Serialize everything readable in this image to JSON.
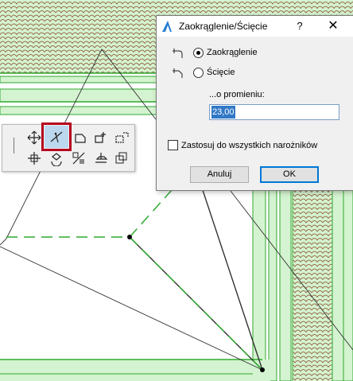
{
  "dialog": {
    "title": "Zaokrąglenie/Ścięcie",
    "help": "?",
    "close": "✕",
    "options": [
      {
        "label": "Zaokrąglenie",
        "checked": true
      },
      {
        "label": "Ścięcie",
        "checked": false
      }
    ],
    "radius_label": "...o promieniu:",
    "radius_value": "23,00",
    "all_corners_label": "Zastosuj do wszystkich narożników",
    "all_corners_checked": false,
    "cancel_label": "Anuluj",
    "ok_label": "OK"
  },
  "toolbar": {
    "tools": [
      {
        "name": "move-icon",
        "active": false
      },
      {
        "name": "fillet-chamfer-icon",
        "active": true
      },
      {
        "name": "offset-corner-icon",
        "active": false
      },
      {
        "name": "add-node-icon",
        "active": false
      },
      {
        "name": "curve-edge-icon",
        "active": false
      },
      {
        "name": "drag-icon",
        "active": false
      },
      {
        "name": "rotate-icon",
        "active": false
      },
      {
        "name": "mirror-icon",
        "active": false
      },
      {
        "name": "elevate-icon",
        "active": false
      },
      {
        "name": "multiply-icon",
        "active": false
      }
    ]
  },
  "colors": {
    "wall_fill": "#d4f3d0",
    "wall_line": "#2faa2f",
    "tile": "#8a4a2a",
    "accent": "#0078d7",
    "highlight": "#b5001e"
  }
}
